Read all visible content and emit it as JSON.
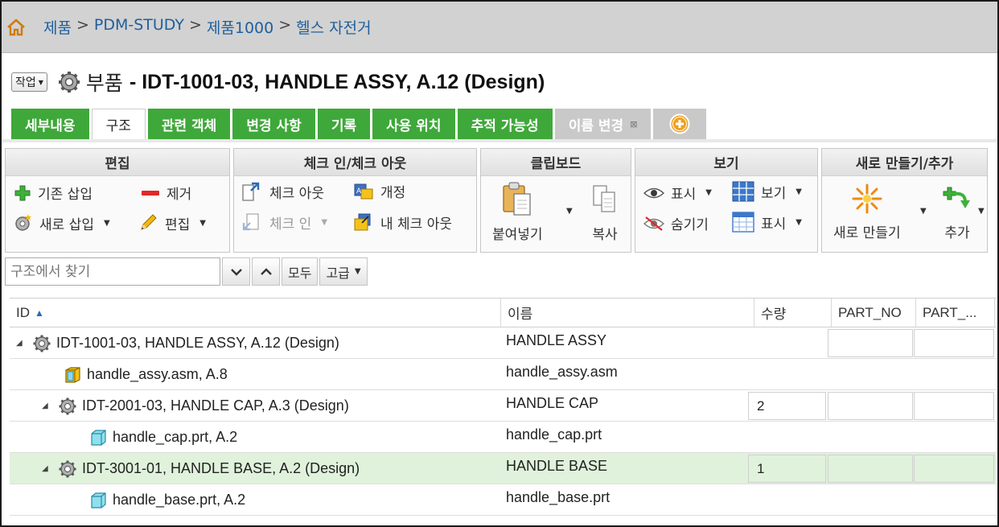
{
  "breadcrumb": {
    "items": [
      "제품",
      "PDM-STUDY",
      "제품1000",
      "헬스 자전거"
    ],
    "separator": ">"
  },
  "header": {
    "actions_label": "작업",
    "type_label": "부품",
    "title": "- IDT-1001-03, HANDLE ASSY, A.12 (Design)"
  },
  "tabs": [
    {
      "label": "세부내용",
      "state": "green"
    },
    {
      "label": "구조",
      "state": "active"
    },
    {
      "label": "관련 객체",
      "state": "green"
    },
    {
      "label": "변경 사항",
      "state": "green"
    },
    {
      "label": "기록",
      "state": "green"
    },
    {
      "label": "사용 위치",
      "state": "green"
    },
    {
      "label": "추적 가능성",
      "state": "green"
    },
    {
      "label": "이름 변경",
      "state": "gray"
    }
  ],
  "ribbon": {
    "edit": {
      "title": "편집",
      "insert_existing": "기존 삽입",
      "remove": "제거",
      "insert_new": "새로 삽입",
      "edit": "편집"
    },
    "checkin": {
      "title": "체크 인/체크 아웃",
      "checkout": "체크 아웃",
      "revise": "개정",
      "checkin": "체크 인",
      "my_checkouts": "내 체크 아웃"
    },
    "clipboard": {
      "title": "클립보드",
      "paste": "붙여넣기",
      "copy": "복사"
    },
    "view": {
      "title": "보기",
      "show": "표시",
      "view": "보기",
      "hide": "숨기기",
      "display": "표시"
    },
    "new": {
      "title": "새로 만들기/추가",
      "new": "새로 만들기",
      "add": "추가"
    }
  },
  "search": {
    "placeholder": "구조에서 찾기",
    "all_label": "모두",
    "advanced_label": "고급"
  },
  "table": {
    "columns": [
      "ID",
      "이름",
      "수량",
      "PART_NO",
      "PART_..."
    ],
    "rows": [
      {
        "id": "IDT-1001-03, HANDLE ASSY, A.12 (Design)",
        "name": "HANDLE ASSY",
        "qty": "",
        "icon": "gear-part",
        "level": 0,
        "expandable": true
      },
      {
        "id": "handle_assy.asm, A.8",
        "name": "handle_assy.asm",
        "qty": null,
        "icon": "cad-assembly",
        "level": 1,
        "expandable": false
      },
      {
        "id": "IDT-2001-03, HANDLE CAP, A.3 (Design)",
        "name": "HANDLE CAP",
        "qty": "2",
        "icon": "gear-part",
        "level": 1,
        "expandable": true
      },
      {
        "id": "handle_cap.prt, A.2",
        "name": "handle_cap.prt",
        "qty": null,
        "icon": "cad-part",
        "level": 2,
        "expandable": false
      },
      {
        "id": "IDT-3001-01, HANDLE BASE, A.2 (Design)",
        "name": "HANDLE BASE",
        "qty": "1",
        "icon": "gear-part",
        "level": 1,
        "expandable": true,
        "selected": true
      },
      {
        "id": "handle_base.prt, A.2",
        "name": "handle_base.prt",
        "qty": null,
        "icon": "cad-part",
        "level": 2,
        "expandable": false
      }
    ]
  },
  "colors": {
    "tab_green": "#3fa83a",
    "link_blue": "#1f5f9c",
    "selected_row": "#e0f2dc",
    "add_orange": "#f0a020"
  }
}
